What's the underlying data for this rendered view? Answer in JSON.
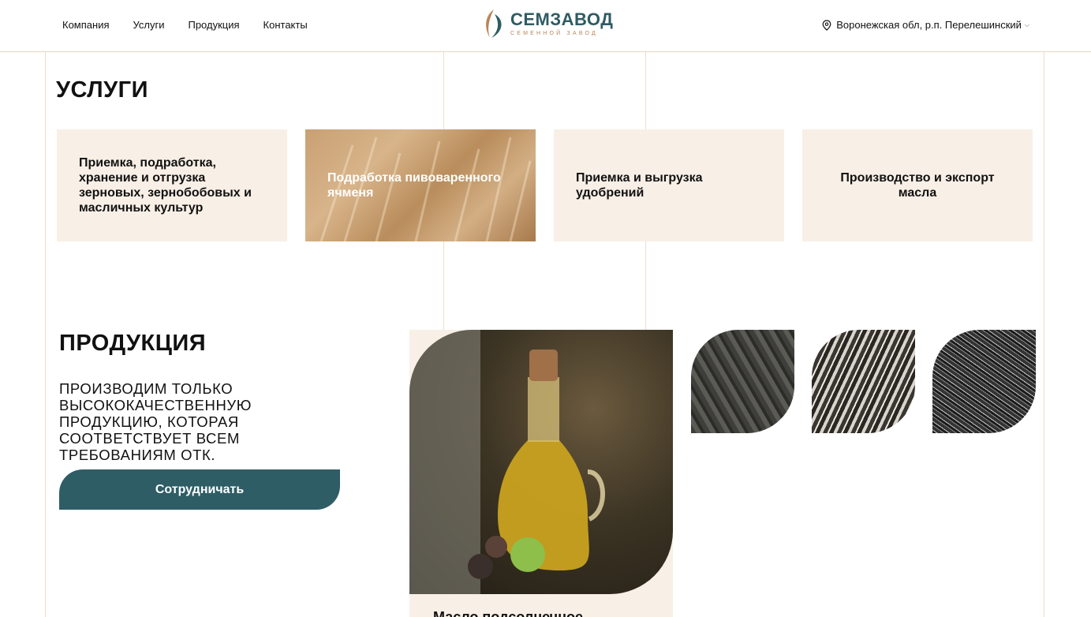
{
  "header": {
    "nav": [
      "Компания",
      "Услуги",
      "Продукция",
      "Контакты"
    ],
    "logo_title": "СЕМЗАВОД",
    "logo_subtitle": "СЕМЕННОЙ ЗАВОД",
    "location": "Воронежская обл, р.п. Перелешинский"
  },
  "services": {
    "title": "УСЛУГИ",
    "cards": [
      "Приемка, подработка, хранение и отгрузка зерновых, зернобобовых и масличных культур",
      "Подработка пивоваренного ячменя",
      "Приемка и выгрузка удобрений",
      "Производство и экспорт масла"
    ]
  },
  "products": {
    "title": "ПРОДУКЦИЯ",
    "lead": "Производим только высококачественную продукцию, которая соответствует всем требованиям ОТК.",
    "cta_label": "Сотрудничать",
    "big_caption": "Масло подсолнечное"
  },
  "colors": {
    "accent": "#2e5d66",
    "card_bg": "#f8efe6",
    "logo_gold": "#b9855a"
  }
}
